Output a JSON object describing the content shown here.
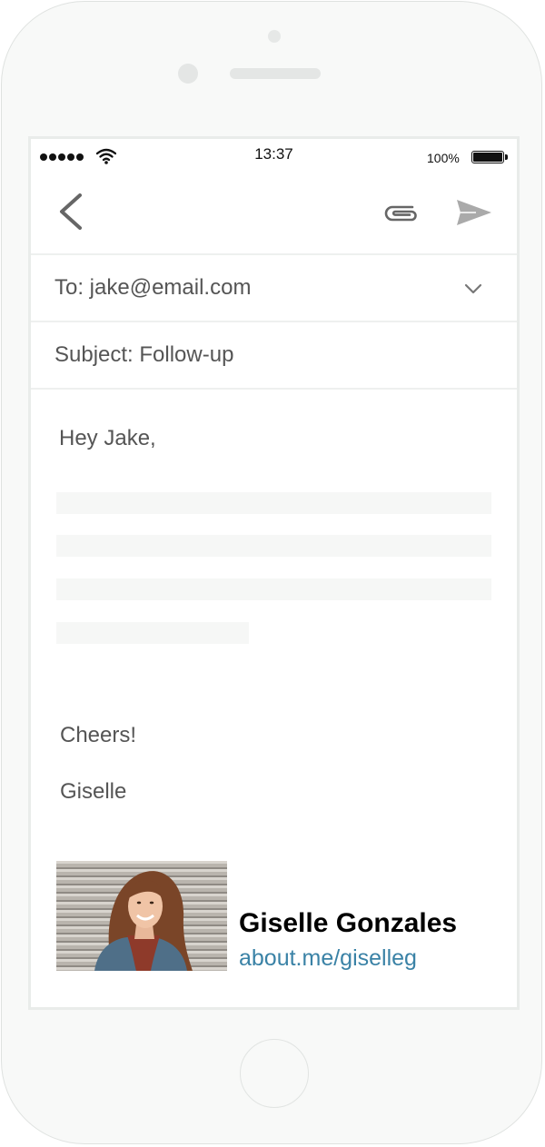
{
  "status_bar": {
    "time": "13:37",
    "battery_percent": "100%",
    "signal_bars": 5
  },
  "toolbar": {
    "back_icon": "chevron-left-icon",
    "attach_icon": "paperclip-icon",
    "send_icon": "send-icon"
  },
  "compose": {
    "to_label": "To: jake@email.com",
    "subject_label": "Subject: Follow-up",
    "greeting": "Hey Jake,",
    "closing": "Cheers!",
    "signoff_name": "Giselle"
  },
  "signature": {
    "name": "Giselle Gonzales",
    "link": "about.me/giselleg",
    "link_color": "#3a82a6"
  },
  "colors": {
    "phone_body": "#f8f9f8",
    "text": "#555555",
    "placeholder": "#f6f7f6"
  }
}
